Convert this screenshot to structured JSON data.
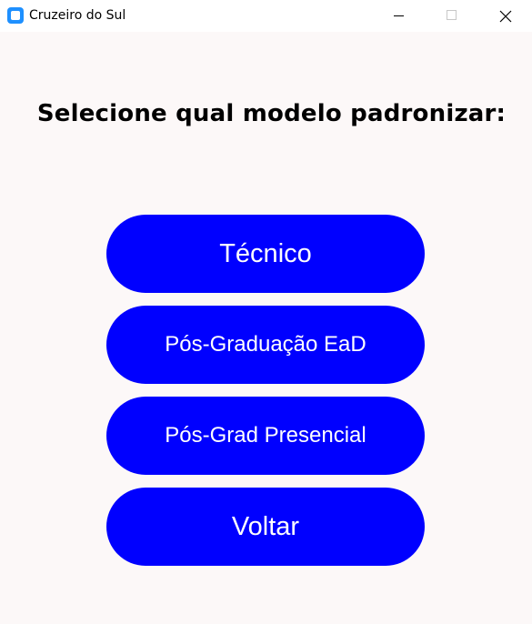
{
  "window": {
    "title": "Cruzeiro do Sul",
    "icons": [
      "app-icon",
      "minimize-icon",
      "maximize-icon",
      "close-icon"
    ]
  },
  "main": {
    "heading": "Selecione qual modelo padronizar:",
    "buttons": [
      {
        "label": "Técnico"
      },
      {
        "label": "Pós-Graduação EaD"
      },
      {
        "label": "Pós-Grad Presencial"
      },
      {
        "label": "Voltar"
      }
    ]
  },
  "colors": {
    "background": "#fcf8f8",
    "button": "#0000ff",
    "button_text": "#ffffff",
    "heading_text": "#000000"
  }
}
